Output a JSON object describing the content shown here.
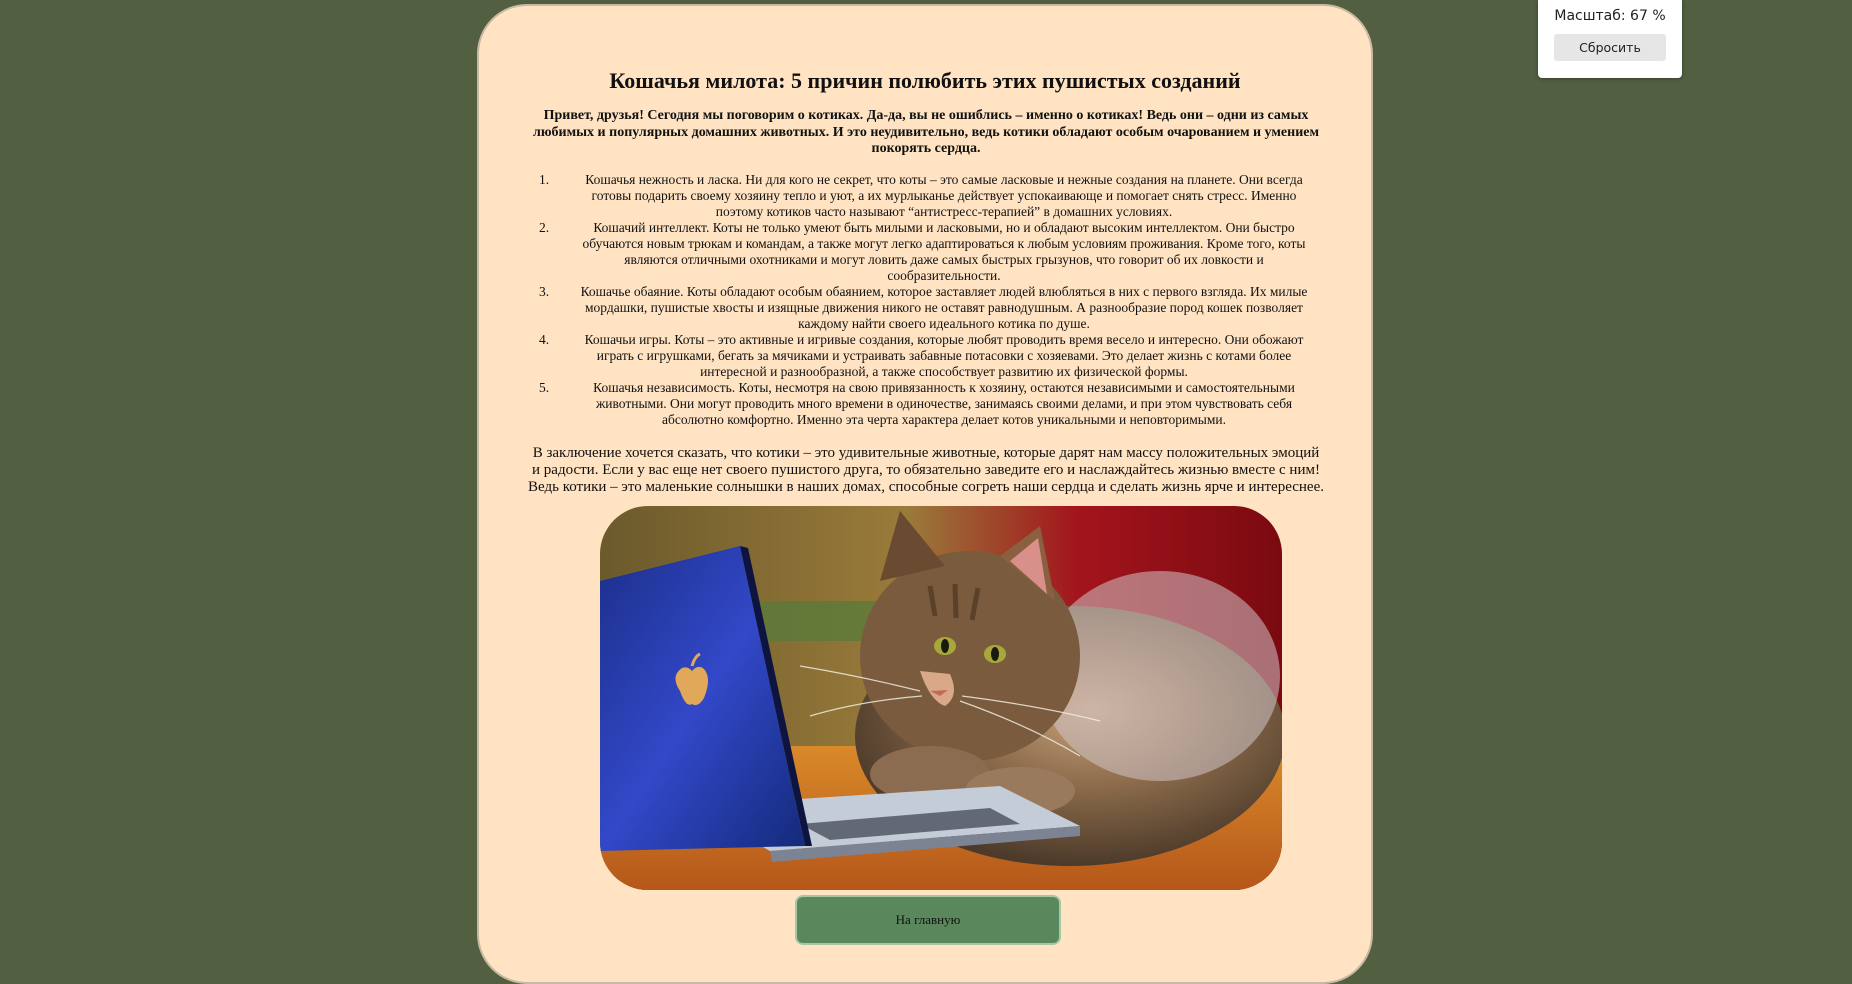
{
  "article": {
    "title": "Кошачья милота: 5 причин полюбить этих пушистых созданий",
    "intro": "Привет, друзья! Сегодня мы поговорим о котиках. Да-да, вы не ошиблись – именно о котиках! Ведь они – одни из самых любимых и популярных домашних животных. И это неудивительно, ведь котики обладают особым очарованием и умением покорять сердца.",
    "reasons": [
      {
        "num": "1.",
        "text": "Кошачья нежность и ласка. Ни для кого не секрет, что коты – это самые ласковые и нежные создания на планете. Они всегда готовы подарить своему хозяину тепло и уют, а их мурлыканье действует успокаивающе и помогает снять стресс. Именно поэтому котиков часто называют “антистресс-терапией” в домашних условиях."
      },
      {
        "num": "2.",
        "text": "Кошачий интеллект. Коты не только умеют быть милыми и ласковыми, но и обладают высоким интеллектом. Они быстро обучаются новым трюкам и командам, а также могут легко адаптироваться к любым условиям проживания. Кроме того, коты являются отличными охотниками и могут ловить даже самых быстрых грызунов, что говорит об их ловкости и сообразительности."
      },
      {
        "num": "3.",
        "text": "Кошачье обаяние. Коты обладают особым обаянием, которое заставляет людей влюбляться в них с первого взгляда. Их милые мордашки, пушистые хвосты и изящные движения никого не оставят равнодушным. А разнообразие пород кошек позволяет каждому найти своего идеального котика по душе."
      },
      {
        "num": "4.",
        "text": "Кошачьи игры. Коты – это активные и игривые создания, которые любят проводить время весело и интересно. Они обожают играть с игрушками, бегать за мячиками и устраивать забавные потасовки с хозяевами. Это делает жизнь с котами более интересной и разнообразной, а также способствует развитию их физической формы."
      },
      {
        "num": "5.",
        "text": "Кошачья независимость. Коты, несмотря на свою привязанность к хозяину, остаются независимыми и самостоятельными животными. Они могут проводить много времени в одиночестве, занимаясь своими делами, и при этом чувствовать себя абсолютно комфортно. Именно эта черта характера делает котов уникальными и неповторимыми."
      }
    ],
    "conclusion": "В заключение хочется сказать, что котики – это удивительные животные, которые дарят нам массу положительных эмоций и радости. Если у вас еще нет своего пушистого друга, то обязательно заведите его и наслаждайтесь жизнью вместе с ним! Ведь котики – это маленькие солнышки в наших домах, способные согреть наши сердца и сделать жизнь ярче и интереснее.",
    "home_button": "На главную"
  },
  "zoom": {
    "label": "Масштаб: 67 %",
    "reset_label": "Сбросить"
  },
  "colors": {
    "page_background": "#526041",
    "card_background": "#ffe3c2",
    "button_background": "#5a875c"
  }
}
